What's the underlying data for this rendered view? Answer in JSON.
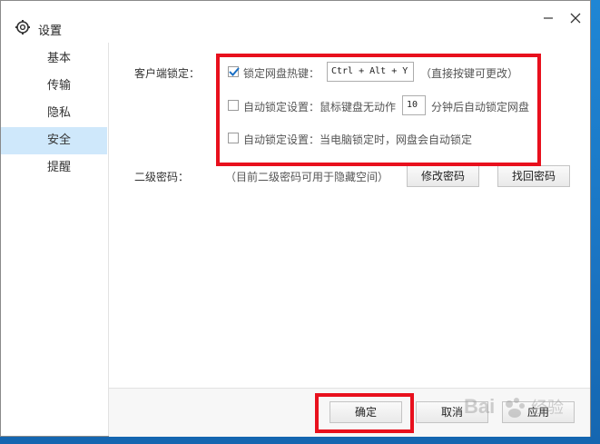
{
  "window": {
    "title": "设置"
  },
  "sidebar": {
    "items": [
      {
        "label": "基本"
      },
      {
        "label": "传输"
      },
      {
        "label": "隐私"
      },
      {
        "label": "安全",
        "active": true
      },
      {
        "label": "提醒"
      }
    ]
  },
  "security": {
    "client_lock_label": "客户端锁定：",
    "hotkey": {
      "checked": true,
      "label": "锁定网盘热键：",
      "value": "Ctrl + Alt + Y",
      "hint": "（直接按键可更改）"
    },
    "auto_lock_idle": {
      "checked": false,
      "label_before": "自动锁定设置：鼠标键盘无动作",
      "minutes": "10",
      "label_after": "分钟后自动锁定网盘"
    },
    "auto_lock_pc": {
      "checked": false,
      "label": "自动锁定设置：当电脑锁定时，网盘会自动锁定"
    },
    "secondary_password_label": "二级密码：",
    "secondary_password_hint": "（目前二级密码可用于隐藏空间）",
    "modify_password_button": "修改密码",
    "recover_password_button": "找回密码"
  },
  "footer": {
    "ok_button": "确定",
    "cancel_button": "取消",
    "apply_button": "应用"
  },
  "watermark": {
    "text": "Bai",
    "sub": "经验"
  },
  "colors": {
    "highlight": "#e8101d",
    "active_tab": "#cfe8fb",
    "desktop": "#1a74c2"
  }
}
